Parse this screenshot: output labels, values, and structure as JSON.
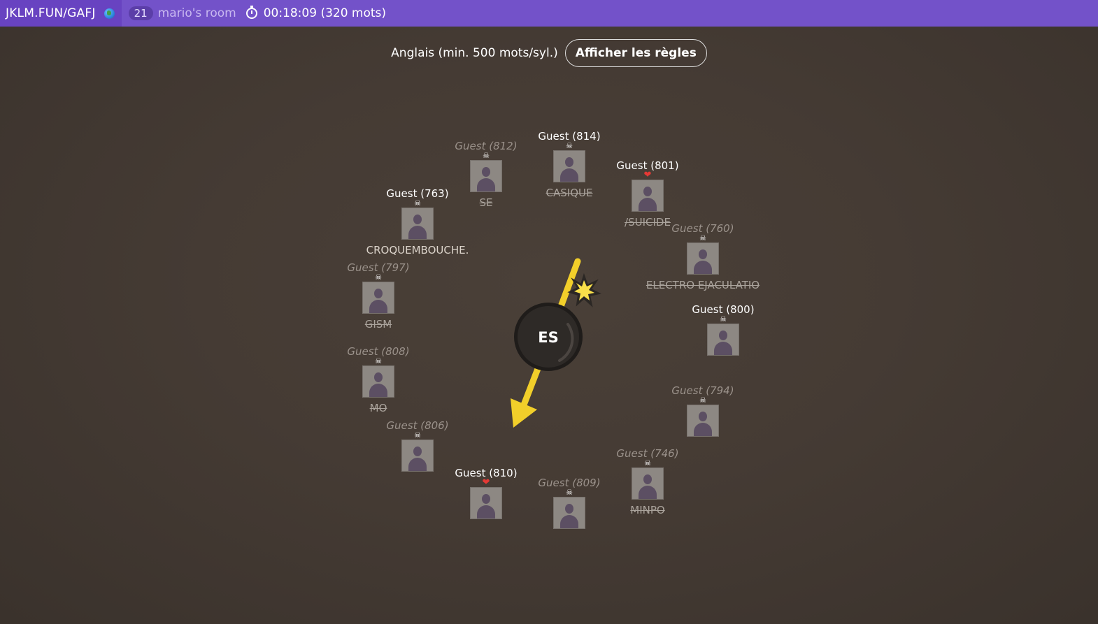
{
  "topbar": {
    "brand": "JKLM.FUN/GAFJ",
    "globe_icon": "globe-icon",
    "room_count": "21",
    "room_name": "mario's room",
    "timer_icon": "stopwatch-icon",
    "timer": "00:18:09 (320 mots)"
  },
  "rules": {
    "dictionary": "Anglais (min. 500 mots/syl.)",
    "button_label": "Afficher les règles"
  },
  "bomb": {
    "syllable": "ES",
    "colors": {
      "bomb": "#2b2724",
      "fuse": "#f2cf2a",
      "arrow": "#f2cf2a"
    }
  },
  "colors": {
    "topbar": "#7352c9",
    "background": "#453b34",
    "heart": "#e53935"
  },
  "players": [
    {
      "name": "Guest (814)",
      "alive": true,
      "status": "skull",
      "word": "CASIQUE",
      "failed": true
    },
    {
      "name": "Guest (801)",
      "alive": true,
      "status": "heart",
      "word": "/SUICIDE",
      "failed": true
    },
    {
      "name": "Guest (760)",
      "alive": false,
      "status": "skull",
      "word": "ELECTRO EJACULATIO",
      "failed": true
    },
    {
      "name": "Guest (800)",
      "alive": true,
      "status": "skull",
      "word": "",
      "failed": false
    },
    {
      "name": "Guest (794)",
      "alive": false,
      "status": "skull",
      "word": "",
      "failed": false
    },
    {
      "name": "Guest (746)",
      "alive": false,
      "status": "skull",
      "word": "MINPO",
      "failed": true
    },
    {
      "name": "Guest (809)",
      "alive": false,
      "status": "skull",
      "word": "",
      "failed": false
    },
    {
      "name": "Guest (810)",
      "alive": true,
      "status": "heart",
      "word": "",
      "failed": false
    },
    {
      "name": "Guest (806)",
      "alive": false,
      "status": "skull",
      "word": "",
      "failed": false
    },
    {
      "name": "Guest (808)",
      "alive": false,
      "status": "skull",
      "word": "MO",
      "failed": true
    },
    {
      "name": "Guest (797)",
      "alive": false,
      "status": "skull",
      "word": "GISM",
      "failed": true
    },
    {
      "name": "Guest (763)",
      "alive": true,
      "status": "skull",
      "word": "CROQUEMBOUCHE.",
      "failed": false
    },
    {
      "name": "Guest (812)",
      "alive": false,
      "status": "skull",
      "word": "SE",
      "failed": true
    }
  ]
}
